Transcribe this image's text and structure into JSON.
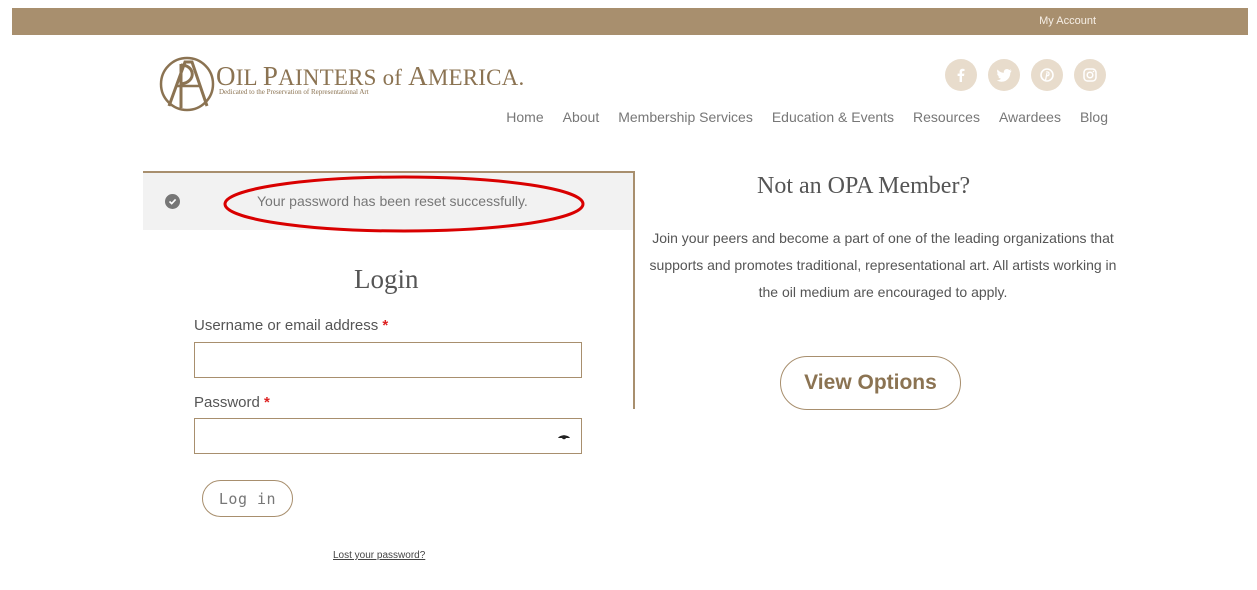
{
  "topbar": {
    "account_label": "My Account"
  },
  "logo": {
    "title_first_cap": "O",
    "title_rest_1": "IL ",
    "title_second_cap": "P",
    "title_rest_2": "AINTERS ",
    "title_of": "of ",
    "title_third_cap": "A",
    "title_rest_3": "MERICA.",
    "subtitle": "Dedicated to the Preservation of Representational Art"
  },
  "social": [
    "facebook-icon",
    "twitter-icon",
    "pinterest-icon",
    "instagram-icon"
  ],
  "nav": {
    "items": [
      "Home",
      "About",
      "Membership Services",
      "Education & Events",
      "Resources",
      "Awardees",
      "Blog"
    ]
  },
  "notice": {
    "text": "Your password has been reset successfully."
  },
  "login": {
    "title": "Login",
    "username_label": "Username or email address",
    "password_label": "Password",
    "required_mark": "*",
    "username_value": "",
    "password_value": "",
    "submit_label": "Log in",
    "lost_password_link": "Lost your password?"
  },
  "promo": {
    "title": "Not an OPA Member?",
    "text": "Join your peers and become a part of one of the leading organizations that supports and promotes traditional, representational art. All artists working in the oil medium are encouraged to apply.",
    "button_label": "View Options"
  },
  "colors": {
    "brand": "#a88f6e",
    "annotation_red": "#d90000"
  }
}
